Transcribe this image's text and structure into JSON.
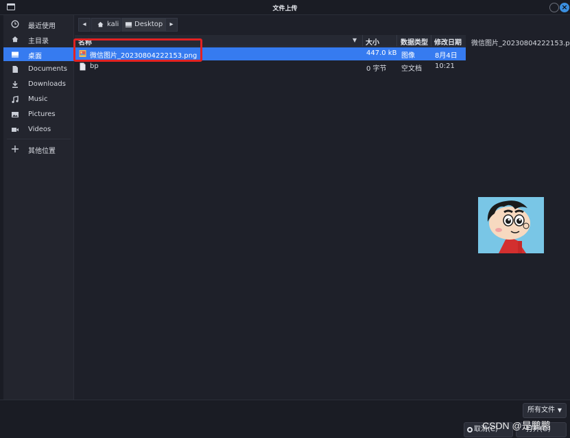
{
  "window": {
    "title": "文件上传"
  },
  "sidebar": {
    "items": [
      {
        "label": "最近使用",
        "icon": "clock-icon"
      },
      {
        "label": "主目录",
        "icon": "home-icon"
      },
      {
        "label": "桌面",
        "icon": "desktop-icon",
        "active": true
      },
      {
        "label": "Documents",
        "icon": "document-icon"
      },
      {
        "label": "Downloads",
        "icon": "download-icon"
      },
      {
        "label": "Music",
        "icon": "music-icon"
      },
      {
        "label": "Pictures",
        "icon": "picture-icon"
      },
      {
        "label": "Videos",
        "icon": "video-icon"
      },
      {
        "label": "其他位置",
        "icon": "plus-icon"
      }
    ]
  },
  "pathbar": {
    "home": "kali",
    "current": "Desktop"
  },
  "filelist": {
    "columns": {
      "name": "名称",
      "size": "大小",
      "type": "数据类型",
      "modified": "修改日期"
    },
    "rows": [
      {
        "name": "微信图片_20230804222153.png",
        "size": "447.0 kB",
        "type": "图像",
        "modified": "8月4日",
        "icon": "image-file-icon",
        "selected": true
      },
      {
        "name": "bp",
        "size": "0 字节",
        "type": "空文档",
        "modified": "10:21",
        "icon": "blank-file-icon",
        "selected": false
      }
    ]
  },
  "preview": {
    "filename": "微信图片_20230804222153.png"
  },
  "bottom": {
    "filter": "所有文件",
    "cancel": "取消(C)",
    "open": "打开(O)",
    "watermark": "CSDN @是鹏鹏"
  },
  "colors": {
    "accent": "#367bf0",
    "background": "#1e2029",
    "highlight": "#e22222"
  }
}
